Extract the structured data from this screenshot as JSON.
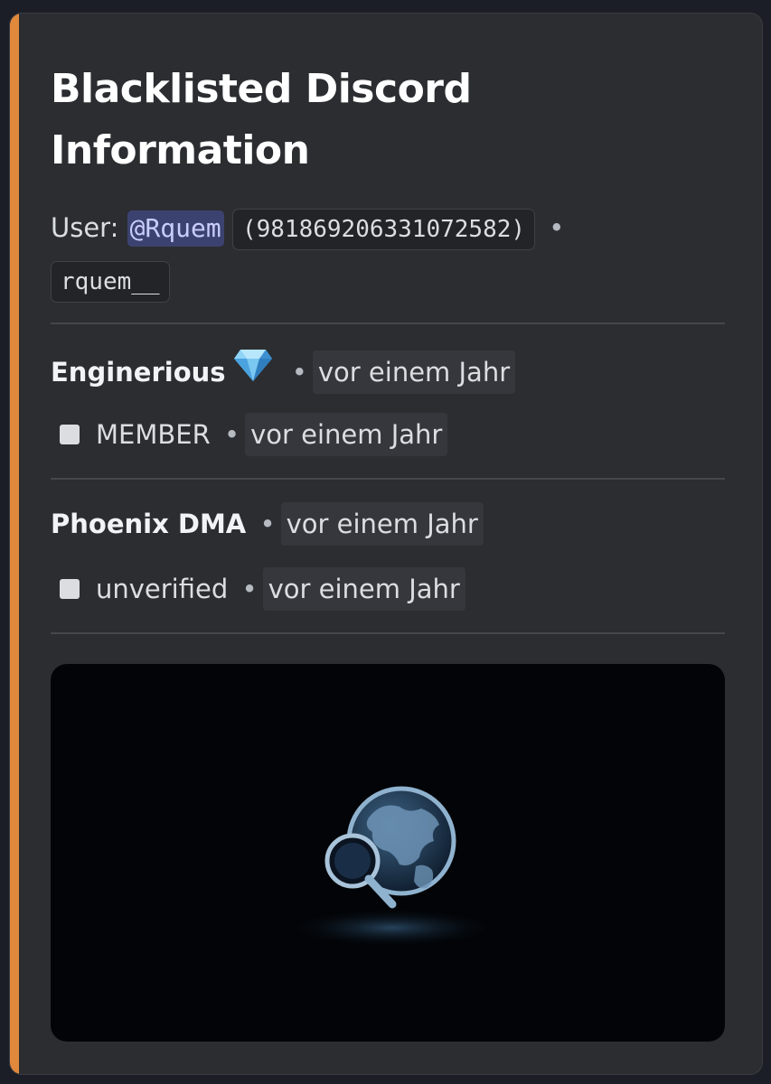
{
  "embed": {
    "accent_color": "#e0883b",
    "title": "Blacklisted Discord Information",
    "user": {
      "label": "User:",
      "mention": "@Rquem",
      "id": "(981869206331072582)",
      "separator": "•",
      "username": "rquem__"
    },
    "servers": [
      {
        "name": "Enginerious",
        "badge_icon": "gem-icon",
        "separator": "•",
        "time": "vor einem Jahr",
        "role": "MEMBER",
        "role_separator": "•",
        "role_time": "vor einem Jahr"
      },
      {
        "name": "Phoenix DMA",
        "separator": "•",
        "time": "vor einem Jahr",
        "role": "unverified",
        "role_separator": "•",
        "role_time": "vor einem Jahr"
      }
    ],
    "image": {
      "icon": "globe-search-icon"
    }
  }
}
